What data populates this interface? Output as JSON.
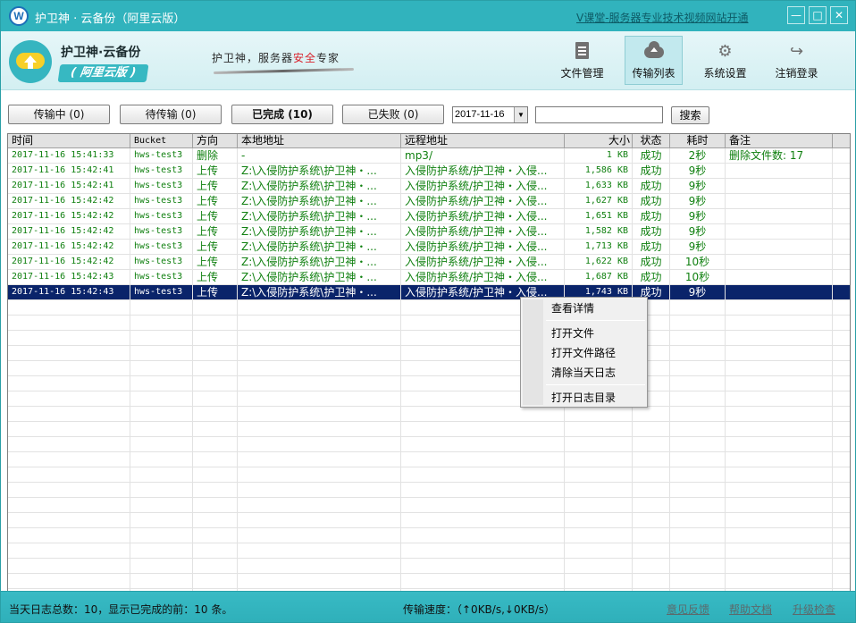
{
  "titlebar": {
    "title": "护卫神 · 云备份（阿里云版）",
    "icon_letter": "W",
    "promo_link": "V课堂-服务器专业技术视频网站开通",
    "min_glyph": "—",
    "max_glyph": "□",
    "close_glyph": "✕"
  },
  "header": {
    "brand_title": "护卫神·云备份",
    "brand_edition": "( 阿里云版 )",
    "slogan_pre": "护卫神，服务器",
    "slogan_highlight": "安全",
    "slogan_post": "专家",
    "nav": [
      {
        "label": "文件管理",
        "icon": "document-icon"
      },
      {
        "label": "传输列表",
        "icon": "cloud-upload-icon"
      },
      {
        "label": "系统设置",
        "icon": "gear-icon"
      },
      {
        "label": "注销登录",
        "icon": "logout-icon"
      }
    ]
  },
  "toolbar": {
    "tabs": [
      "传输中 (0)",
      "待传输 (0)",
      "已完成 (10)",
      "已失败 (0)"
    ],
    "selected_tab": 2,
    "date_value": "2017-11-16",
    "search_value": "",
    "search_label": "搜索"
  },
  "grid": {
    "columns": [
      "时间",
      "Bucket",
      "方向",
      "本地地址",
      "远程地址",
      "大小",
      "状态",
      "耗时",
      "备注"
    ],
    "rows": [
      {
        "time": "2017-11-16 15:41:33",
        "bucket": "hws-test3",
        "direction": "删除",
        "local": "-",
        "remote": "mp3/",
        "size": "1 KB",
        "status": "成功",
        "elapsed": "2秒",
        "note": "删除文件数: 17"
      },
      {
        "time": "2017-11-16 15:42:41",
        "bucket": "hws-test3",
        "direction": "上传",
        "local": "Z:\\入侵防护系统\\护卫神・...",
        "remote": "入侵防护系统/护卫神・入侵...",
        "size": "1,586 KB",
        "status": "成功",
        "elapsed": "9秒",
        "note": ""
      },
      {
        "time": "2017-11-16 15:42:41",
        "bucket": "hws-test3",
        "direction": "上传",
        "local": "Z:\\入侵防护系统\\护卫神・...",
        "remote": "入侵防护系统/护卫神・入侵...",
        "size": "1,633 KB",
        "status": "成功",
        "elapsed": "9秒",
        "note": ""
      },
      {
        "time": "2017-11-16 15:42:42",
        "bucket": "hws-test3",
        "direction": "上传",
        "local": "Z:\\入侵防护系统\\护卫神・...",
        "remote": "入侵防护系统/护卫神・入侵...",
        "size": "1,627 KB",
        "status": "成功",
        "elapsed": "9秒",
        "note": ""
      },
      {
        "time": "2017-11-16 15:42:42",
        "bucket": "hws-test3",
        "direction": "上传",
        "local": "Z:\\入侵防护系统\\护卫神・...",
        "remote": "入侵防护系统/护卫神・入侵...",
        "size": "1,651 KB",
        "status": "成功",
        "elapsed": "9秒",
        "note": ""
      },
      {
        "time": "2017-11-16 15:42:42",
        "bucket": "hws-test3",
        "direction": "上传",
        "local": "Z:\\入侵防护系统\\护卫神・...",
        "remote": "入侵防护系统/护卫神・入侵...",
        "size": "1,582 KB",
        "status": "成功",
        "elapsed": "9秒",
        "note": ""
      },
      {
        "time": "2017-11-16 15:42:42",
        "bucket": "hws-test3",
        "direction": "上传",
        "local": "Z:\\入侵防护系统\\护卫神・...",
        "remote": "入侵防护系统/护卫神・入侵...",
        "size": "1,713 KB",
        "status": "成功",
        "elapsed": "9秒",
        "note": ""
      },
      {
        "time": "2017-11-16 15:42:42",
        "bucket": "hws-test3",
        "direction": "上传",
        "local": "Z:\\入侵防护系统\\护卫神・...",
        "remote": "入侵防护系统/护卫神・入侵...",
        "size": "1,622 KB",
        "status": "成功",
        "elapsed": "10秒",
        "note": ""
      },
      {
        "time": "2017-11-16 15:42:43",
        "bucket": "hws-test3",
        "direction": "上传",
        "local": "Z:\\入侵防护系统\\护卫神・...",
        "remote": "入侵防护系统/护卫神・入侵...",
        "size": "1,687 KB",
        "status": "成功",
        "elapsed": "10秒",
        "note": ""
      },
      {
        "time": "2017-11-16 15:42:43",
        "bucket": "hws-test3",
        "direction": "上传",
        "local": "Z:\\入侵防护系统\\护卫神・...",
        "remote": "入侵防护系统/护卫神・入侵...",
        "size": "1,743 KB",
        "status": "成功",
        "elapsed": "9秒",
        "note": ""
      }
    ],
    "selected_row": 9
  },
  "context_menu": {
    "items": [
      "查看详情",
      "打开文件",
      "打开文件路径",
      "清除当天日志",
      "打开日志目录"
    ]
  },
  "statusbar": {
    "summary": "当天日志总数：10，显示已完成的前：10 条。",
    "speed": "传输速度：（↑0KB/s,↓0KB/s）",
    "links": [
      "意见反馈",
      "帮助文档",
      "升级检查"
    ]
  },
  "colors": {
    "accent": "#31b3bd",
    "row_text": "#108010",
    "selected_row": "#0a246a",
    "slogan_highlight": "#d9232d"
  }
}
